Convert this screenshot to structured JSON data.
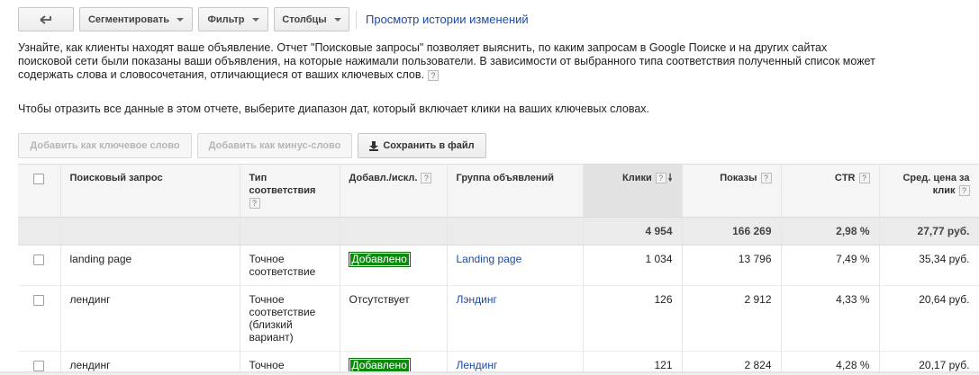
{
  "toolbar": {
    "back_icon": "back-arrow-icon",
    "segment_label": "Сегментировать",
    "filter_label": "Фильтр",
    "columns_label": "Столбцы",
    "history_link": "Просмотр истории изменений"
  },
  "description": {
    "line1": "Узнайте, как клиенты находят ваше объявление. Отчет \"Поисковые запросы\" позволяет выяснить, по каким запросам в Google Поиске и на других сайтах",
    "line2": "поисковой сети были показаны ваши объявления, на которые нажимали пользователи. В зависимости от выбранного типа соответствия полученный список может",
    "line3": "содержать слова и словосочетания, отличающиеся от ваших ключевых слов.",
    "date_hint": "Чтобы отразить все данные в этом отчете, выберите диапазон дат, который включает клики на ваших ключевых словах."
  },
  "actions": {
    "add_keyword": "Добавить как ключевое слово",
    "add_negative": "Добавить как минус-слово",
    "save_file": "Сохранить в файл"
  },
  "help_mark": "?",
  "table": {
    "headers": {
      "query": "Поисковый запрос",
      "match_type_1": "Тип",
      "match_type_2": "соответствия",
      "added": "Добавл./искл.",
      "adgroup": "Группа объявлений",
      "clicks": "Клики",
      "impressions": "Показы",
      "ctr": "CTR",
      "cpc_1": "Сред. цена за",
      "cpc_2": "клик"
    },
    "totals": {
      "clicks": "4 954",
      "impressions": "166 269",
      "ctr": "2,98 %",
      "cpc": "27,77 руб."
    },
    "rows": [
      {
        "query": "landing page",
        "match_1": "Точное",
        "match_2": "соответствие",
        "match_3": "",
        "match_4": "",
        "added": "Добавлено",
        "added_badge": true,
        "adgroup": "Landing page",
        "clicks": "1 034",
        "impressions": "13 796",
        "ctr": "7,49 %",
        "cpc": "35,34 руб."
      },
      {
        "query": "лендинг",
        "match_1": "Точное",
        "match_2": "соответствие",
        "match_3": "(близкий",
        "match_4": "вариант)",
        "added": "Отсутствует",
        "added_badge": false,
        "adgroup": "Лэндинг",
        "clicks": "126",
        "impressions": "2 912",
        "ctr": "4,33 %",
        "cpc": "20,64 руб."
      },
      {
        "query": "лендинг",
        "match_1": "Точное",
        "match_2": "",
        "match_3": "",
        "match_4": "",
        "added": "Добавлено",
        "added_badge": true,
        "adgroup": "Лендинг",
        "clicks": "121",
        "impressions": "2 824",
        "ctr": "4,28 %",
        "cpc": "20,17 руб."
      }
    ]
  },
  "colors": {
    "link": "#1a4ba8",
    "added_badge": "#0a8a0a",
    "sorted_header": "#e2e2e2",
    "totals_row": "#ebebeb"
  }
}
